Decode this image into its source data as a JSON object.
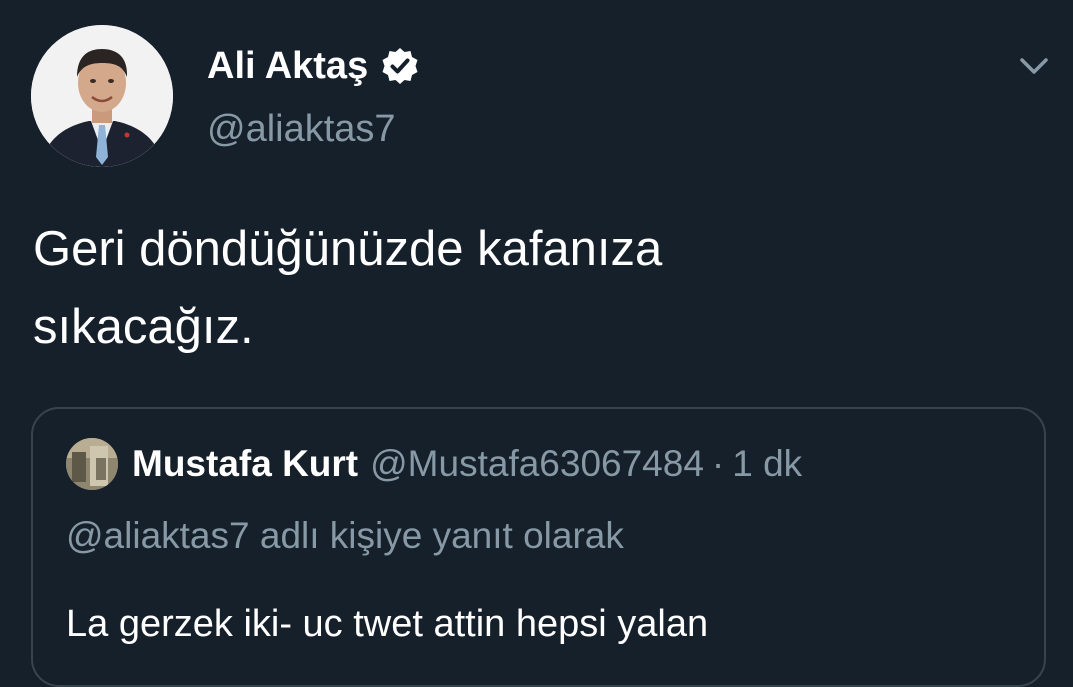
{
  "tweet": {
    "author": {
      "name": "Ali Aktaş",
      "handle": "@aliaktas7",
      "verified": true,
      "avatar_icon": "profile-photo-man-in-suit"
    },
    "text_lines": [
      "Geri döndüğünüzde kafanıza",
      "sıkacağız."
    ],
    "menu_icon": "chevron-down-icon",
    "quoted": {
      "author_name": "Mustafa Kurt",
      "author_handle": "@Mustafa63067484",
      "separator": "·",
      "time": "1 dk",
      "reply_context": "@aliaktas7 adlı kişiye yanıt olarak",
      "text": "La gerzek iki- uc twet attin hepsi yalan"
    }
  },
  "colors": {
    "background": "#15202b",
    "primary_text": "#ffffff",
    "secondary_text": "#8899a6",
    "border": "#38444d",
    "verified_badge": "#ffffff"
  }
}
